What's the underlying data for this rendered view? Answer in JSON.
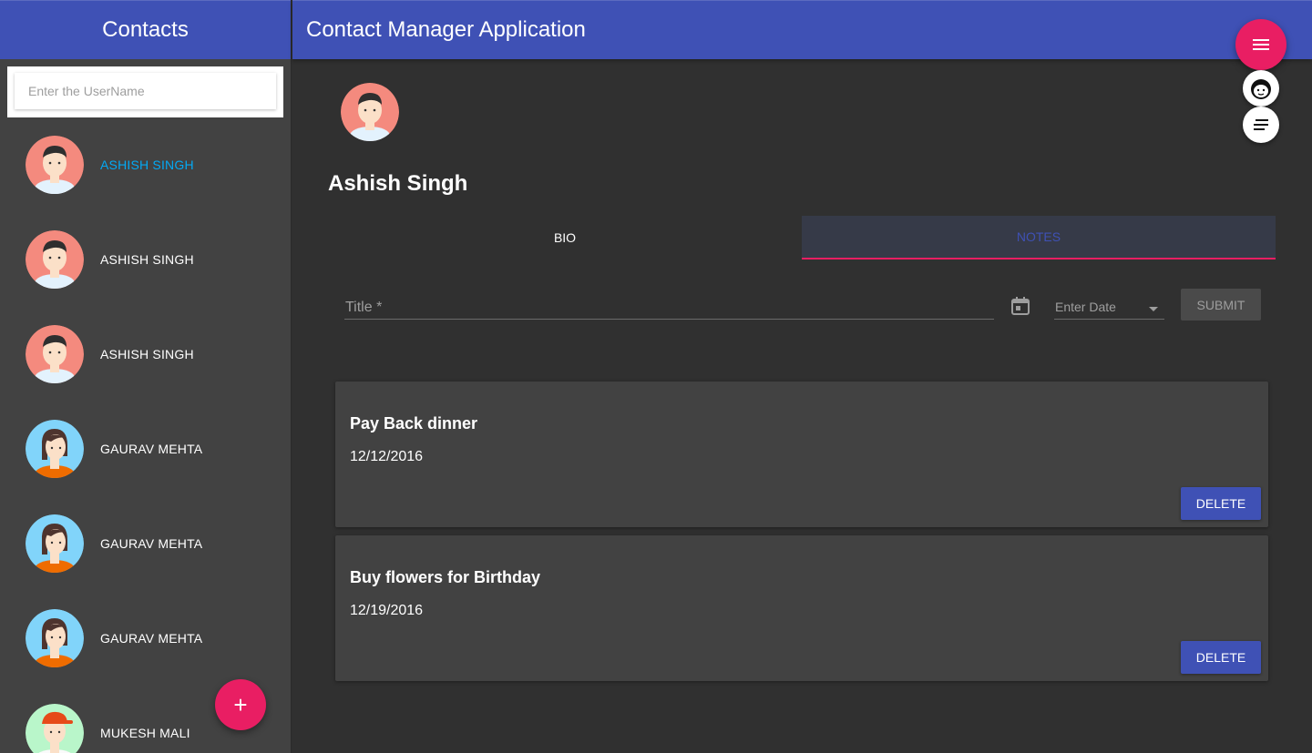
{
  "sidebar": {
    "title": "Contacts",
    "search_placeholder": "Enter the UserName",
    "contacts": [
      {
        "name": "ASHISH SINGH",
        "avatar": "boy-avatar",
        "active": true
      },
      {
        "name": "ASHISH SINGH",
        "avatar": "boy-avatar",
        "active": false
      },
      {
        "name": "ASHISH SINGH",
        "avatar": "boy-avatar",
        "active": false
      },
      {
        "name": "GAURAV MEHTA",
        "avatar": "girl-avatar",
        "active": false
      },
      {
        "name": "GAURAV MEHTA",
        "avatar": "girl-avatar",
        "active": false
      },
      {
        "name": "GAURAV MEHTA",
        "avatar": "girl-avatar",
        "active": false
      },
      {
        "name": "MUKESH MALI",
        "avatar": "cap-boy-avatar",
        "active": false
      }
    ],
    "add_button_label": "+"
  },
  "header": {
    "title": "Contact Manager Application"
  },
  "fab": {
    "menu_icon": "menu-icon",
    "face_icon": "face-icon",
    "notes_icon": "notes-icon"
  },
  "profile": {
    "name": "Ashish Singh"
  },
  "tabs": [
    {
      "label": "BIO",
      "active": false
    },
    {
      "label": "NOTES",
      "active": true
    }
  ],
  "form": {
    "title_label": "Title *",
    "date_placeholder": "Enter Date",
    "submit_label": "SUBMIT"
  },
  "notes": [
    {
      "title": "Pay Back dinner",
      "date": "12/12/2016",
      "delete_label": "DELETE"
    },
    {
      "title": "Buy flowers for Birthday",
      "date": "12/19/2016",
      "delete_label": "DELETE"
    }
  ],
  "colors": {
    "primary": "#3f51b5",
    "accent": "#e91e63",
    "active_contact": "#03a9f4",
    "background": "#303030",
    "card": "#424242"
  }
}
